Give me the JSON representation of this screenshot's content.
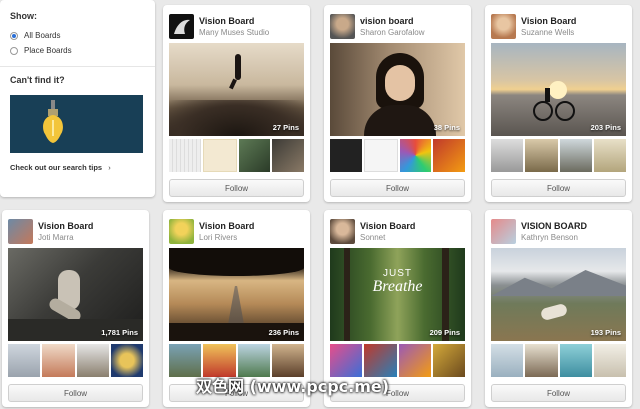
{
  "sidebar": {
    "show_label": "Show:",
    "options": [
      {
        "label": "All Boards",
        "checked": true
      },
      {
        "label": "Place Boards",
        "checked": false
      }
    ],
    "cant_find": "Can't find it?",
    "search_tips": "Check out our search tips",
    "tips_arrow": "›"
  },
  "boards": [
    {
      "title": "Vision Board",
      "user": "Many Muses Studio",
      "pins": "27 Pins",
      "follow": "Follow"
    },
    {
      "title": "vision board",
      "user": "Sharon Garofalow",
      "pins": "38 Pins",
      "follow": "Follow"
    },
    {
      "title": "Vision Board",
      "user": "Suzanne Wells",
      "pins": "203 Pins",
      "follow": "Follow"
    },
    {
      "title": "Vision Board",
      "user": "Joti Marra",
      "pins": "1,781 Pins",
      "follow": "Follow"
    },
    {
      "title": "Vision Board",
      "user": "Lori Rivers",
      "pins": "236 Pins",
      "follow": "Follow"
    },
    {
      "title": "Vision Board",
      "user": "Sonnet",
      "pins": "209 Pins",
      "follow": "Follow",
      "cover_text_1": "JUST",
      "cover_text_2": "Breathe"
    },
    {
      "title": "VISION BOARD",
      "user": "Kathryn Benson",
      "pins": "193 Pins",
      "follow": "Follow"
    }
  ],
  "watermark": "双色网 (www.pcpc.me)"
}
